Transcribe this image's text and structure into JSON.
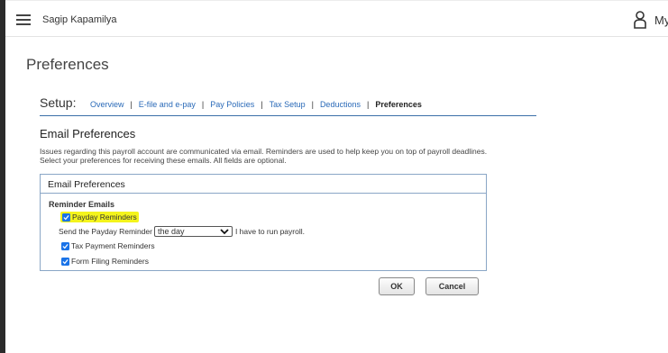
{
  "topbar": {
    "company_name": "Sagip Kapamilya",
    "user_label": "My"
  },
  "page": {
    "title": "Preferences"
  },
  "setup_nav": {
    "label": "Setup:",
    "items": [
      {
        "label": "Overview"
      },
      {
        "label": "E-file and e-pay"
      },
      {
        "label": "Pay Policies"
      },
      {
        "label": "Tax Setup"
      },
      {
        "label": "Deductions"
      },
      {
        "label": "Preferences"
      }
    ],
    "separator": "|"
  },
  "email_prefs": {
    "title": "Email Preferences",
    "description_line1": "Issues regarding this payroll account are communicated via email. Reminders are used to help keep you on top of payroll deadlines.",
    "description_line2": "Select your preferences for receiving these emails. All fields are optional.",
    "box_title": "Email Preferences",
    "reminder_title": "Reminder Emails",
    "payday_label": "Payday Reminders",
    "send_prefix": "Send the Payday Reminder",
    "send_select_value": "the day",
    "send_suffix": "I have to run payroll.",
    "tax_label": "Tax Payment Reminders",
    "form_label": "Form Filing Reminders"
  },
  "buttons": {
    "ok": "OK",
    "cancel": "Cancel"
  },
  "colors": {
    "accent": "#2a6ab8",
    "checkbox": "#1a73e8",
    "highlight": "#f4f41c",
    "divider": "#3b6fa8"
  }
}
